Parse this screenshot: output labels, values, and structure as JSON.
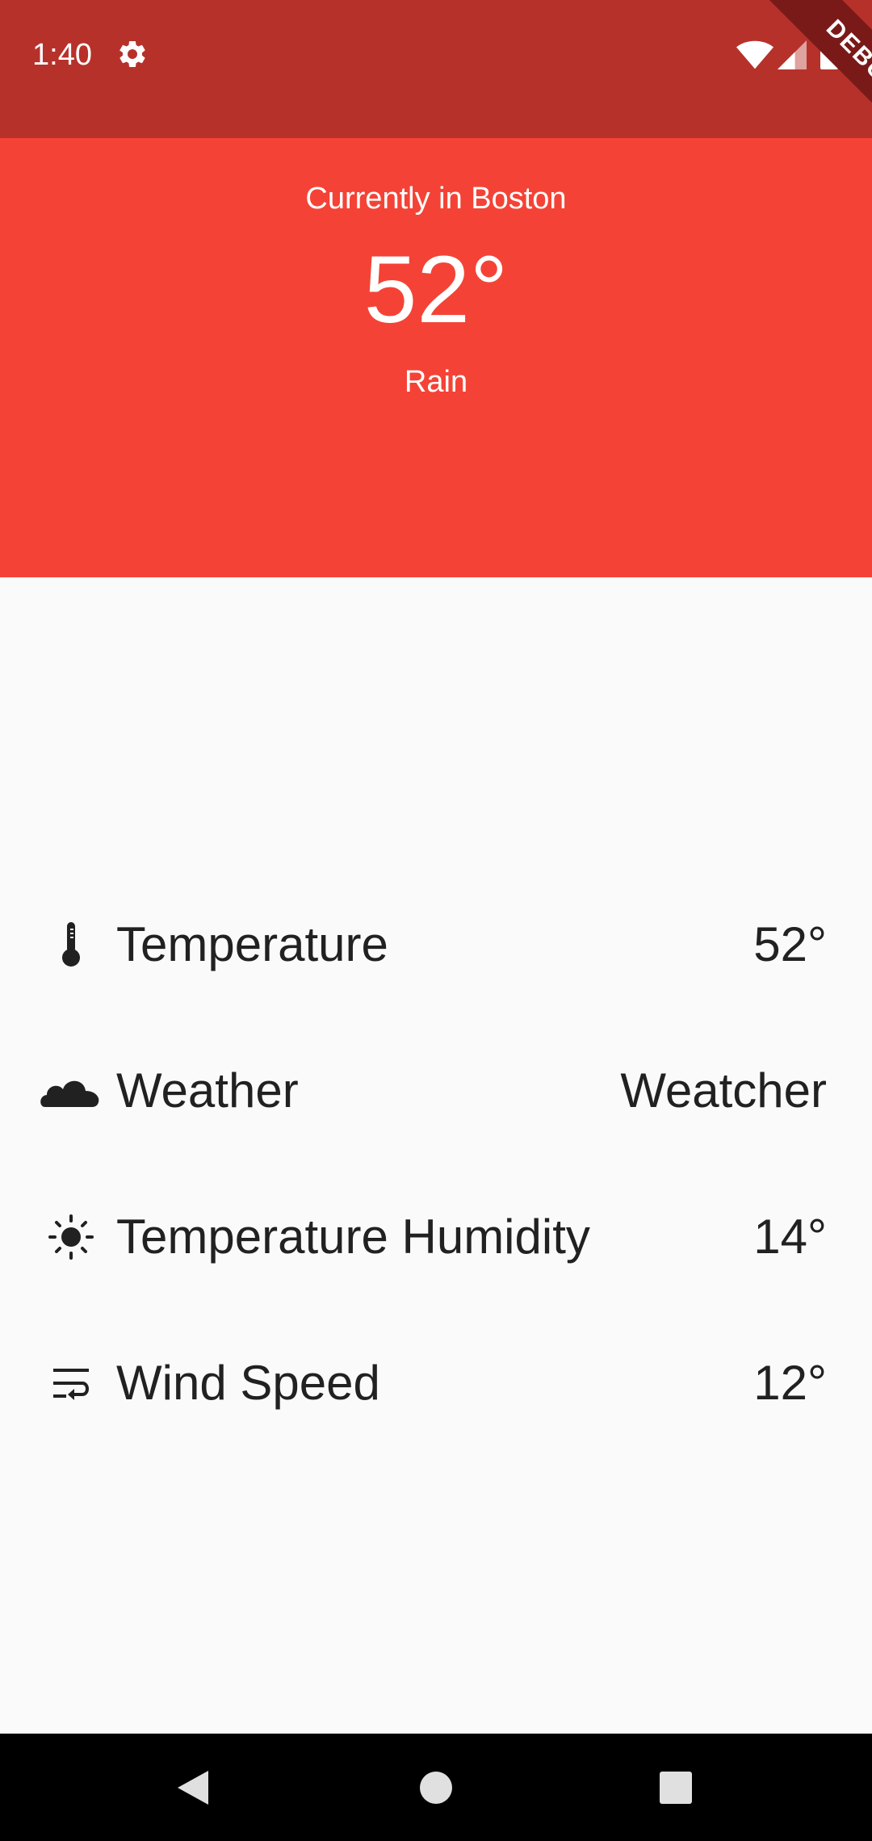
{
  "status_bar": {
    "time": "1:40",
    "icons": [
      "gear-icon",
      "wifi-icon",
      "signal-icon",
      "battery-icon"
    ],
    "debug_label": "DEBUG"
  },
  "header": {
    "location": "Currently in Boston",
    "temperature": "52°",
    "condition": "Rain",
    "color": "#f44336"
  },
  "details": [
    {
      "icon": "thermometer-icon",
      "label": "Temperature",
      "value": "52°"
    },
    {
      "icon": "cloud-icon",
      "label": "Weather",
      "value": "Weatcher"
    },
    {
      "icon": "sun-icon",
      "label": "Temperature Humidity",
      "value": "14°"
    },
    {
      "icon": "wrap-text-icon",
      "label": "Wind Speed",
      "value": "12°"
    }
  ],
  "nav_bar": {
    "buttons": [
      "back-icon",
      "home-icon",
      "recents-icon"
    ]
  }
}
